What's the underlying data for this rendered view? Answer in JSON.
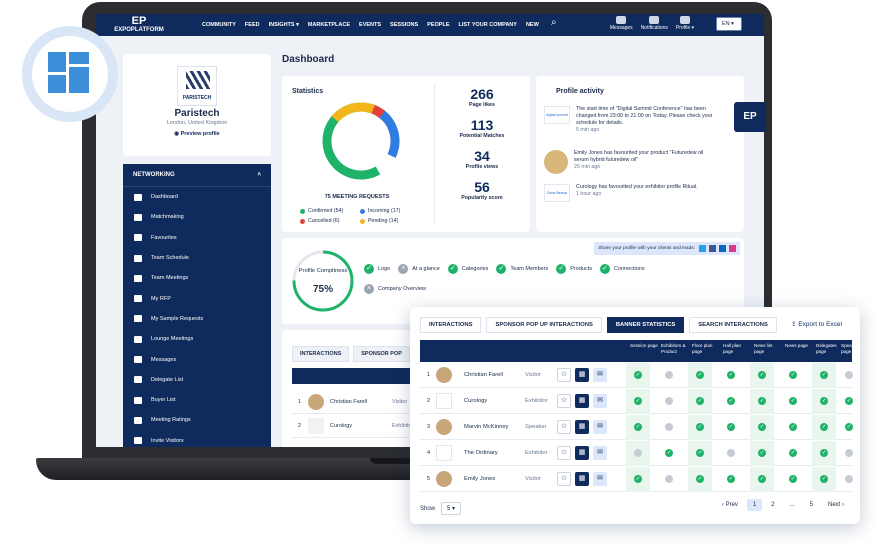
{
  "topnav": {
    "logo_top": "EP",
    "logo_text": "EXPOPLATFORM",
    "items": [
      "COMMUNITY",
      "FEED",
      "INSIGHTS ▾",
      "MARKETPLACE",
      "EVENTS",
      "SESSIONS",
      "PEOPLE",
      "LIST YOUR COMPANY",
      "NEW"
    ],
    "icons": [
      "Messages",
      "Notifications",
      "Profile ▾"
    ],
    "lang": "EN"
  },
  "profile": {
    "logo_text": "PARISTECH",
    "name": "Paristech",
    "location": "London, United Kingdom",
    "preview": "Preview profile"
  },
  "sidebar": {
    "section": "NETWORKING",
    "items": [
      "Dashboard",
      "Matchmaking",
      "Favourites",
      "Team Schedule",
      "Team Meetings",
      "My RFP",
      "My Sample Requests",
      "Lounge Meetings",
      "Messages",
      "Delegate List",
      "Buyer List",
      "Meeting Ratings",
      "Invite Visitors"
    ]
  },
  "main": {
    "title": "Dashboard",
    "statistics": {
      "title": "Statistics",
      "donut_label": "75 MEETING REQUESTS",
      "legend": [
        {
          "label": "Confirmed (54)",
          "color": "#1fb36a"
        },
        {
          "label": "Incoming (17)",
          "color": "#2f7de1"
        },
        {
          "label": "Cancelled (6)",
          "color": "#e2403a"
        },
        {
          "label": "Pending (14)",
          "color": "#f2b61b"
        }
      ],
      "stats": [
        {
          "num": "266",
          "label": "Page likes"
        },
        {
          "num": "113",
          "label": "Potential Matches"
        },
        {
          "num": "34",
          "label": "Profile views"
        },
        {
          "num": "56",
          "label": "Popularity score"
        }
      ]
    },
    "activity": {
      "title": "Profile activity",
      "items": [
        {
          "img": "digital summit",
          "text": "The start time of \"Digital Summit Conference\" has been changed from 23:00 to 21:00 on Today. Please check your schedule for details.",
          "time": "5 min ago"
        },
        {
          "img": "",
          "text": "Emily Jones has favourited your product \"Futuredew oil serum hybrid futuredew oil\"",
          "time": "25 min ago"
        },
        {
          "img": "Gene Beauty",
          "text": "Curology has favourited your exhibitor profile Ritual.",
          "time": "1 hour ago"
        }
      ]
    },
    "completeness": {
      "share": "Share your profile with your clients and leads:",
      "title": "Profile Compltness",
      "value": "75%",
      "checks": [
        {
          "label": "Logo",
          "ok": true
        },
        {
          "label": "At a glance",
          "ok": false
        },
        {
          "label": "Categories",
          "ok": true
        },
        {
          "label": "Team Members",
          "ok": true
        },
        {
          "label": "Products",
          "ok": true
        },
        {
          "label": "Connections",
          "ok": true
        },
        {
          "label": "Company Overview",
          "ok": false
        }
      ]
    },
    "bg_table": {
      "tabs": [
        "INTERACTIONS",
        "SPONSOR POP"
      ],
      "rows": [
        {
          "n": "1",
          "name": "Christian Farell",
          "role": "Visitor"
        },
        {
          "n": "2",
          "name": "Curology",
          "role": "Exhibitor"
        }
      ]
    }
  },
  "panel": {
    "tabs": [
      "INTERACTIONS",
      "SPONSOR POP UP INTERACTIONS",
      "BANNER STATISTICS",
      "SEARCH INTERACTIONS"
    ],
    "active_tab": 2,
    "export": "Export to Excel",
    "columns": [
      "Session page",
      "Exhibitors & Product",
      "Floor plan page",
      "Hall plan page",
      "News list page",
      "News page",
      "Delegates page",
      "Speakers page"
    ],
    "rows": [
      {
        "n": "1",
        "name": "Christian Farell",
        "role": "Visitor",
        "logo": false,
        "status": [
          true,
          false,
          true,
          true,
          true,
          true,
          true,
          false
        ]
      },
      {
        "n": "2",
        "name": "Curology",
        "role": "Exhibitor",
        "logo": true,
        "status": [
          true,
          false,
          true,
          true,
          true,
          true,
          true,
          true
        ]
      },
      {
        "n": "3",
        "name": "Marvin McKinney",
        "role": "Speaker",
        "logo": false,
        "status": [
          true,
          false,
          true,
          true,
          true,
          true,
          true,
          true
        ]
      },
      {
        "n": "4",
        "name": "The Ordinary",
        "role": "Exhibitor",
        "logo": true,
        "status": [
          false,
          true,
          true,
          false,
          true,
          true,
          true,
          false
        ]
      },
      {
        "n": "5",
        "name": "Emily Jones",
        "role": "Visitor",
        "logo": false,
        "status": [
          true,
          false,
          true,
          true,
          true,
          true,
          true,
          false
        ]
      }
    ],
    "show_label": "Show",
    "show_value": "5",
    "pager": [
      "‹ Prev",
      "1",
      "2",
      "...",
      "5",
      "Next ›"
    ]
  },
  "badge": "EP"
}
